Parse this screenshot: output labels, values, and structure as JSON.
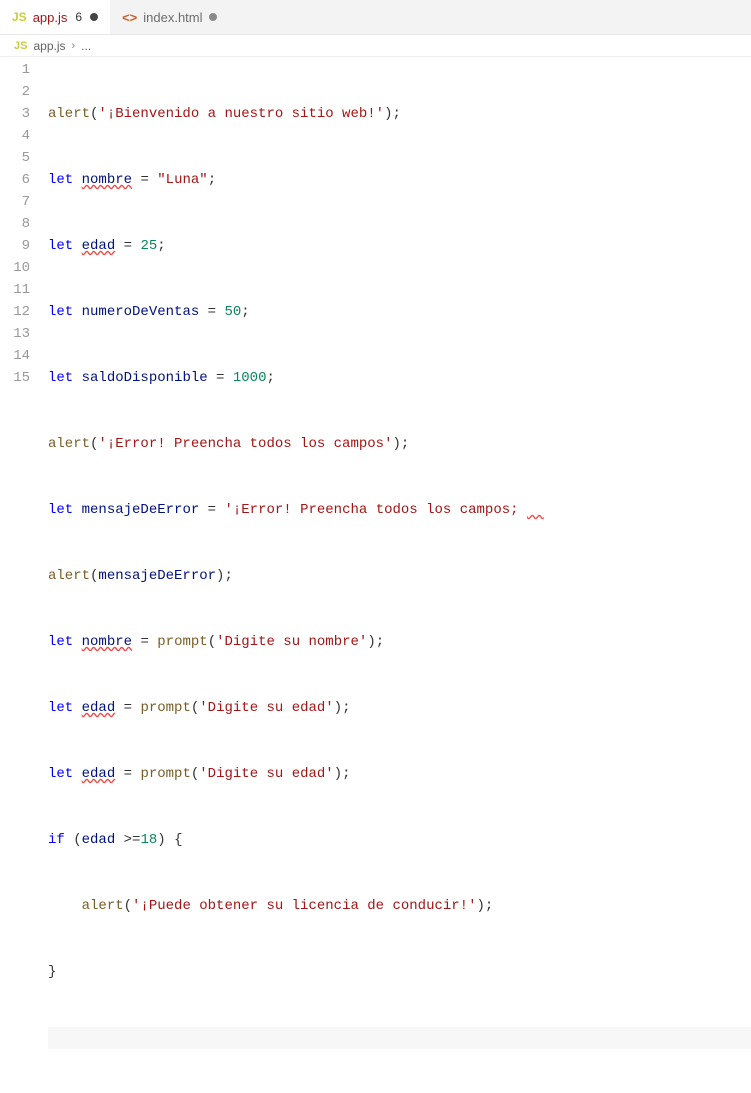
{
  "tabs": [
    {
      "icon": "JS",
      "name": "app.js",
      "badge": "6",
      "modified": true,
      "active": true
    },
    {
      "icon": "<>",
      "name": "index.html",
      "badge": null,
      "modified": true,
      "active": false
    }
  ],
  "breadcrumb": {
    "icon": "JS",
    "file": "app.js",
    "more": "..."
  },
  "lineNumbers": [
    "1",
    "2",
    "3",
    "4",
    "5",
    "6",
    "7",
    "8",
    "9",
    "10",
    "11",
    "12",
    "13",
    "14",
    "15"
  ],
  "code": {
    "l1": {
      "fn": "alert",
      "open": "(",
      "str": "'¡Bienvenido a nuestro sitio web!'",
      "close": ");"
    },
    "l2": {
      "kw": "let",
      "var": "nombre",
      "eq": " = ",
      "str": "\"Luna\"",
      "end": ";"
    },
    "l3": {
      "kw": "let",
      "var": "edad",
      "eq": " = ",
      "num": "25",
      "end": ";"
    },
    "l4": {
      "kw": "let",
      "var": "numeroDeVentas",
      "eq": " = ",
      "num": "50",
      "end": ";"
    },
    "l5": {
      "kw": "let",
      "var": "saldoDisponible",
      "eq": " = ",
      "num": "1000",
      "end": ";"
    },
    "l6": {
      "fn": "alert",
      "open": "(",
      "str": "'¡Error! Preencha todos los campos'",
      "close": ");"
    },
    "l7": {
      "kw": "let",
      "var": "mensajeDeError",
      "eq": " = ",
      "str": "'¡Error! Preencha todos los campos;"
    },
    "l8": {
      "fn": "alert",
      "open": "(",
      "var": "mensajeDeError",
      "close": ");"
    },
    "l9": {
      "kw": "let",
      "var": "nombre",
      "eq": " = ",
      "fn2": "prompt",
      "open2": "(",
      "str": "'Digite su nombre'",
      "close2": ");"
    },
    "l10": {
      "kw": "let",
      "var": "edad",
      "eq": " = ",
      "fn2": "prompt",
      "open2": "(",
      "str": "'Digite su edad'",
      "close2": ");"
    },
    "l11": {
      "kw": "let",
      "var": "edad",
      "eq": " = ",
      "fn2": "prompt",
      "open2": "(",
      "str": "'Digite su edad'",
      "close2": ");"
    },
    "l12": {
      "kw": "if",
      "open": " (",
      "var": "edad",
      "op": " >=",
      "num": "18",
      "close": ") {"
    },
    "l13": {
      "indent": "    ",
      "fn": "alert",
      "open": "(",
      "str": "'¡Puede obtener su licencia de conducir!'",
      "close": ");"
    },
    "l14": {
      "text": "}"
    },
    "l15": {
      "text": ""
    }
  }
}
